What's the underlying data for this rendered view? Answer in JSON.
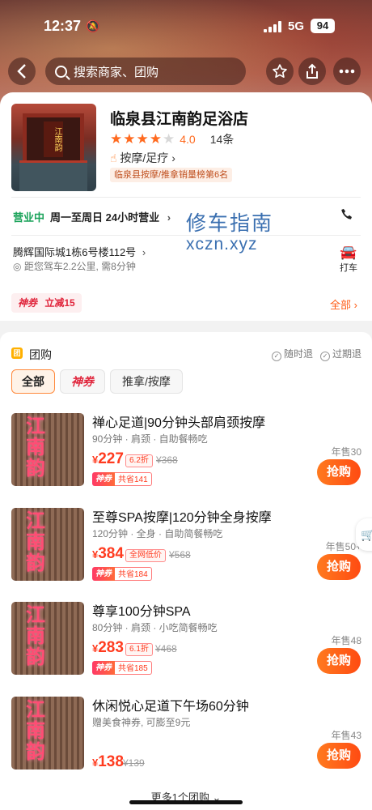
{
  "status": {
    "time": "12:37",
    "network": "5G",
    "battery": "94"
  },
  "navbar": {
    "search_placeholder": "搜索商家、团购"
  },
  "shop": {
    "name": "临泉县江南韵足浴店",
    "rating": "4.0",
    "reviews": "14条",
    "category": "按摩/足疗",
    "rank_badge": "临泉县按摩/推拿销量榜第6名",
    "thumb_sign": "江南韵",
    "open_status": "营业中",
    "hours": "周一至周日 24小时营业",
    "address": "腾辉国际城1栋6号楼112号",
    "distance": "距您驾车2.2公里, 需8分钟",
    "taxi_label": "打车"
  },
  "watermark": {
    "line1": "修车指南",
    "line2": "xczn.xyz"
  },
  "coupon": {
    "brand": "神券",
    "text": "立减15",
    "all_label": "全部"
  },
  "group": {
    "section_label": "团购",
    "section_icon_text": "团",
    "policy_any": "随时退",
    "policy_expired": "过期退",
    "filters": [
      {
        "label": "全部"
      },
      {
        "label": "神券"
      },
      {
        "label": "推拿/按摩"
      }
    ],
    "deals": [
      {
        "title": "禅心足道|90分钟头部肩颈按摩",
        "subtitle": "90分钟 · 肩颈 · 自助餐畅吃",
        "img_text": "江南韵",
        "price": "227",
        "discount": "6.2折",
        "original": "¥368",
        "save_brand": "神券",
        "save": "共省141",
        "sold": "年售30",
        "buy": "抢购"
      },
      {
        "title": "至尊SPA按摩|120分钟全身按摩",
        "subtitle": "120分钟 · 全身 · 自助简餐畅吃",
        "img_text": "江南韵",
        "price": "384",
        "discount": "全网低价",
        "original": "¥568",
        "save_brand": "神券",
        "save": "共省184",
        "sold": "年售50+",
        "buy": "抢购"
      },
      {
        "title": "尊享100分钟SPA",
        "subtitle": "80分钟 · 肩颈 · 小吃简餐畅吃",
        "img_text": "江南韵",
        "price": "283",
        "discount": "6.1折",
        "original": "¥468",
        "save_brand": "神券",
        "save": "共省185",
        "sold": "年售48",
        "buy": "抢购"
      },
      {
        "title": "休闲悦心足道下午场60分钟",
        "subtitle": "赠美食神券, 可膨至9元",
        "img_text": "江南韵",
        "price": "138",
        "original": "¥139",
        "sold": "年售43",
        "buy": "抢购"
      }
    ],
    "more_label": "更多1个团购"
  },
  "colors": {
    "accent": "#ff5b14",
    "price": "#ff3b1f",
    "open": "#1aa35a",
    "watermark": "#3a6fb0"
  }
}
